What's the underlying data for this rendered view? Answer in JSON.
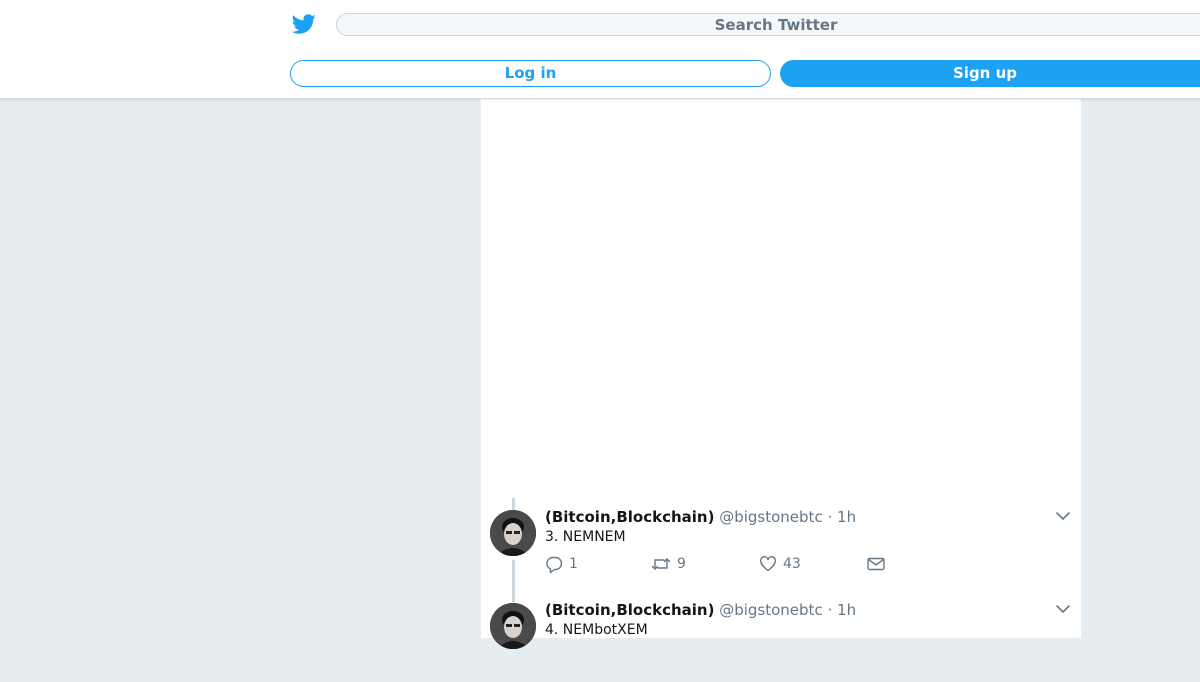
{
  "header": {
    "search_placeholder": "Search Twitter",
    "login_label": "Log in",
    "signup_label": "Sign up",
    "brand_color": "#1da1f2",
    "logo_icon": "twitter-bird-icon"
  },
  "tweets": [
    {
      "name": "(Bitcoin,Blockchain)",
      "handle": "@bigstonebtc",
      "separator": "·",
      "time": "1h",
      "text": "3. NEMNEM",
      "replies": "1",
      "retweets": "9",
      "likes": "43"
    },
    {
      "name": "(Bitcoin,Blockchain)",
      "handle": "@bigstonebtc",
      "separator": "·",
      "time": "1h",
      "text": "4. NEMbotXEM"
    }
  ]
}
